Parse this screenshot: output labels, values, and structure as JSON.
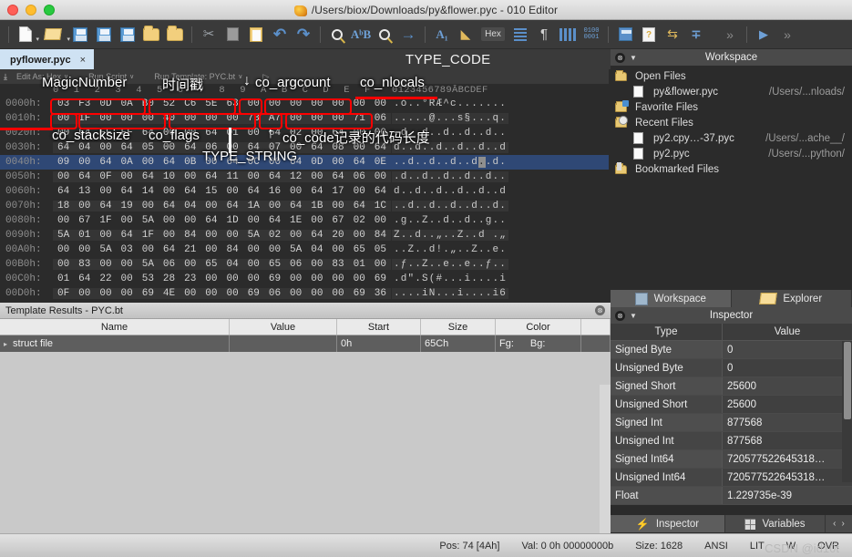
{
  "window": {
    "title": "/Users/biox/Downloads/py&flower.pyc - 010 Editor",
    "app_icon": "010-editor-icon"
  },
  "toolbar": {
    "items": [
      {
        "name": "new-file",
        "icon": "document-icon"
      },
      {
        "name": "open-file",
        "icon": "folder-open-icon"
      },
      {
        "name": "save-file",
        "icon": "floppy-disk-icon"
      },
      {
        "name": "save-as",
        "icon": "floppy-disk-copy-icon"
      },
      {
        "name": "save-all",
        "icon": "floppy-disk-stack-icon"
      },
      {
        "name": "open-folder",
        "icon": "folder-icon"
      },
      {
        "name": "open-folder-multi",
        "icon": "folder-stack-icon"
      },
      {
        "name": "cut",
        "icon": "scissors-icon"
      },
      {
        "name": "copy",
        "icon": "copy-icon"
      },
      {
        "name": "paste",
        "icon": "clipboard-icon"
      },
      {
        "name": "undo",
        "icon": "undo-arrow-icon"
      },
      {
        "name": "redo",
        "icon": "redo-arrow-icon"
      },
      {
        "name": "find",
        "icon": "magnifier-icon"
      },
      {
        "name": "replace",
        "icon": "find-replace-icon"
      },
      {
        "name": "find-in-files",
        "icon": "find-files-icon"
      },
      {
        "name": "goto",
        "icon": "arrow-right-icon"
      },
      {
        "name": "select-range",
        "icon": "font-size-icon"
      },
      {
        "name": "highlight",
        "icon": "highlighter-icon"
      },
      {
        "name": "hex-mode",
        "icon": "hex-label-icon",
        "label": "Hex"
      },
      {
        "name": "text-wrap",
        "icon": "wrap-lines-icon"
      },
      {
        "name": "show-paragraph",
        "icon": "pilcrow-icon"
      },
      {
        "name": "column-mode",
        "icon": "columns-icon"
      },
      {
        "name": "binary-view",
        "icon": "binary-0100-icon",
        "label_top": "0100",
        "label_bottom": "0001"
      },
      {
        "name": "calculator",
        "icon": "calculator-icon"
      },
      {
        "name": "checksum",
        "icon": "checksum-doc-icon"
      },
      {
        "name": "convert",
        "icon": "swap-arrows-icon"
      },
      {
        "name": "base-convert",
        "icon": "plus-minus-icon"
      },
      {
        "name": "step-over",
        "icon": "double-chevron-icon"
      },
      {
        "name": "run",
        "icon": "play-icon"
      },
      {
        "name": "run-all",
        "icon": "double-chevron2-icon"
      }
    ]
  },
  "tabbar": {
    "active_tab": "pyflower.pyc",
    "close_glyph": "×",
    "center_label": "TYPE_CODE",
    "nav_prev": "‹",
    "nav_next": "›",
    "nav_list": "⌄",
    "nav_close": "⊗"
  },
  "hex_subtoolbar": {
    "collapse_glyph": "⤓",
    "edit_as": "Edit As: Hex",
    "run_script": "Run Script",
    "run_template": "Run Template: PYC.bt",
    "play_glyph": "▷",
    "chevron": "∨"
  },
  "hex_editor": {
    "offset_header": "",
    "byte_column_labels": "0 1 2 3 4 5 6 7 8 9 A B C D E F",
    "ascii_header": "0123456789ĀBCDEF",
    "rows": [
      {
        "offset": "0000h:",
        "bytes": [
          "03",
          "F3",
          "0D",
          "0A",
          "B0",
          "52",
          "C6",
          "5E",
          "63",
          "00",
          "00",
          "00",
          "00",
          "00",
          "00",
          "00"
        ],
        "ascii": ".ó..°RÆ^c......."
      },
      {
        "offset": "0010h:",
        "bytes": [
          "00",
          "1F",
          "00",
          "00",
          "00",
          "40",
          "00",
          "00",
          "00",
          "73",
          "A7",
          "00",
          "00",
          "00",
          "71",
          "06"
        ],
        "ascii": ".....@...s§...q."
      },
      {
        "offset": "0020h:",
        "bytes": [
          "00",
          "64",
          "FF",
          "FF",
          "64",
          "00",
          "00",
          "64",
          "01",
          "00",
          "64",
          "02",
          "00",
          "64",
          "00",
          "00"
        ],
        "ascii": ".d..d..d..d..d.."
      },
      {
        "offset": "0030h:",
        "bytes": [
          "64",
          "04",
          "00",
          "64",
          "05",
          "00",
          "64",
          "06",
          "00",
          "64",
          "07",
          "00",
          "64",
          "08",
          "00",
          "64"
        ],
        "ascii": "d..d..d..d..d..d"
      },
      {
        "offset": "0040h:",
        "bytes": [
          "09",
          "00",
          "64",
          "0A",
          "00",
          "64",
          "0B",
          "00",
          "64",
          "0C",
          "00",
          "64",
          "0D",
          "00",
          "64",
          "0E"
        ],
        "ascii": "..d..d..d..d..d.",
        "selected": true,
        "caret_index": 12
      },
      {
        "offset": "0050h:",
        "bytes": [
          "00",
          "64",
          "0F",
          "00",
          "64",
          "10",
          "00",
          "64",
          "11",
          "00",
          "64",
          "12",
          "00",
          "64",
          "06",
          "00"
        ],
        "ascii": ".d..d..d..d..d.."
      },
      {
        "offset": "0060h:",
        "bytes": [
          "64",
          "13",
          "00",
          "64",
          "14",
          "00",
          "64",
          "15",
          "00",
          "64",
          "16",
          "00",
          "64",
          "17",
          "00",
          "64"
        ],
        "ascii": "d..d..d..d..d..d"
      },
      {
        "offset": "0070h:",
        "bytes": [
          "18",
          "00",
          "64",
          "19",
          "00",
          "64",
          "04",
          "00",
          "64",
          "1A",
          "00",
          "64",
          "1B",
          "00",
          "64",
          "1C"
        ],
        "ascii": "..d..d..d..d..d."
      },
      {
        "offset": "0080h:",
        "bytes": [
          "00",
          "67",
          "1F",
          "00",
          "5A",
          "00",
          "00",
          "64",
          "1D",
          "00",
          "64",
          "1E",
          "00",
          "67",
          "02",
          "00"
        ],
        "ascii": ".g..Z..d..d..g.."
      },
      {
        "offset": "0090h:",
        "bytes": [
          "5A",
          "01",
          "00",
          "64",
          "1F",
          "00",
          "84",
          "00",
          "00",
          "5A",
          "02",
          "00",
          "64",
          "20",
          "00",
          "84"
        ],
        "ascii": "Z..d..„..Z..d .„"
      },
      {
        "offset": "00A0h:",
        "bytes": [
          "00",
          "00",
          "5A",
          "03",
          "00",
          "64",
          "21",
          "00",
          "84",
          "00",
          "00",
          "5A",
          "04",
          "00",
          "65",
          "05"
        ],
        "ascii": "..Z..d!.„..Z..e."
      },
      {
        "offset": "00B0h:",
        "bytes": [
          "00",
          "83",
          "00",
          "00",
          "5A",
          "06",
          "00",
          "65",
          "04",
          "00",
          "65",
          "06",
          "00",
          "83",
          "01",
          "00"
        ],
        "ascii": ".ƒ..Z..e..e..ƒ.."
      },
      {
        "offset": "00C0h:",
        "bytes": [
          "01",
          "64",
          "22",
          "00",
          "53",
          "28",
          "23",
          "00",
          "00",
          "00",
          "69",
          "00",
          "00",
          "00",
          "00",
          "69"
        ],
        "ascii": ".d\".S(#...i....i"
      },
      {
        "offset": "00D0h:",
        "bytes": [
          "0F",
          "00",
          "00",
          "00",
          "69",
          "4E",
          "00",
          "00",
          "00",
          "69",
          "06",
          "00",
          "00",
          "00",
          "69",
          "36"
        ],
        "ascii": "....iN...i....i6"
      }
    ]
  },
  "annotations": {
    "labels": [
      {
        "name": "magic-number-label",
        "text": "MagicNumber"
      },
      {
        "name": "timestamp-label",
        "text": "时间戳"
      },
      {
        "name": "co-argcount-label",
        "text": "co_argcount"
      },
      {
        "name": "co-nlocals-label",
        "text": "co_nlocals"
      },
      {
        "name": "co-stacksize-label",
        "text": "co_stacksize"
      },
      {
        "name": "co-flags-label",
        "text": "co_flags"
      },
      {
        "name": "co-code-label",
        "text": "co_code记录的代码长度"
      },
      {
        "name": "type-string-label",
        "text": "TYPE_STRING"
      }
    ]
  },
  "template_results": {
    "title": "Template Results - PYC.bt",
    "close_glyph": "⊗",
    "columns": [
      "Name",
      "Value",
      "Start",
      "Size",
      "Color",
      ""
    ],
    "rows": [
      {
        "expand": "▸",
        "name": "struct file",
        "value": "",
        "start": "0h",
        "size": "65Ch",
        "color_fg": "Fg:",
        "color_bg": "Bg:"
      }
    ]
  },
  "workspace": {
    "header_title": "Workspace",
    "close_glyph": "⊗",
    "menu_glyph": "▼",
    "items": [
      {
        "name": "open-files-group",
        "label": "Open Files",
        "path": "",
        "icon": "folder-open-icon",
        "child": false
      },
      {
        "name": "open-file-pyflower",
        "label": "py&flower.pyc",
        "path": "/Users/...nloads/",
        "icon": "document-icon",
        "child": true
      },
      {
        "name": "favorite-files-group",
        "label": "Favorite Files",
        "path": "",
        "icon": "folder-star-icon",
        "child": false
      },
      {
        "name": "recent-files-group",
        "label": "Recent Files",
        "path": "",
        "icon": "folder-clock-icon",
        "child": false
      },
      {
        "name": "recent-file-py2cpy37",
        "label": "py2.cpy…-37.pyc",
        "path": "/Users/...ache__/",
        "icon": "document-icon",
        "child": true
      },
      {
        "name": "recent-file-py2",
        "label": "py2.pyc",
        "path": "/Users/...python/",
        "icon": "document-icon",
        "child": true
      },
      {
        "name": "bookmarked-files-group",
        "label": "Bookmarked Files",
        "path": "",
        "icon": "folder-bookmark-icon",
        "child": false
      }
    ],
    "tabs": [
      {
        "name": "tab-workspace",
        "label": "Workspace",
        "icon": "stack-icon",
        "selected": true
      },
      {
        "name": "tab-explorer",
        "label": "Explorer",
        "icon": "folder-open-icon",
        "selected": false
      }
    ]
  },
  "inspector": {
    "header_title": "Inspector",
    "close_glyph": "⊗",
    "menu_glyph": "▼",
    "columns": [
      "Type",
      "Value"
    ],
    "rows": [
      {
        "type": "Signed Byte",
        "value": "0"
      },
      {
        "type": "Unsigned Byte",
        "value": "0"
      },
      {
        "type": "Signed Short",
        "value": "25600"
      },
      {
        "type": "Unsigned Short",
        "value": "25600"
      },
      {
        "type": "Signed Int",
        "value": "877568"
      },
      {
        "type": "Unsigned Int",
        "value": "877568"
      },
      {
        "type": "Signed Int64",
        "value": "720577522645318…"
      },
      {
        "type": "Unsigned Int64",
        "value": "720577522645318…"
      },
      {
        "type": "Float",
        "value": "1.229735e-39"
      }
    ],
    "tabs": [
      {
        "name": "tab-inspector",
        "label": "Inspector",
        "icon": "bolt-icon",
        "selected": true
      },
      {
        "name": "tab-variables",
        "label": "Variables",
        "icon": "grid-icon",
        "selected": false
      }
    ],
    "nav_prev": "‹",
    "nav_next": "›"
  },
  "statusbar": {
    "pos": "Pos: 74 [4Ah]",
    "val": "Val: 0 0h 00000000b",
    "size": "Size: 1628",
    "encoding": "ANSI",
    "endian": "LIT",
    "width": "W",
    "mode": "OVR"
  },
  "watermark": "CSDN @id10t",
  "colors": {
    "accent_red": "#ff0000",
    "tab_active_bg": "#cfe2f3",
    "selection_blue": "#2f4875",
    "panel_bg": "#2b2b2b"
  }
}
